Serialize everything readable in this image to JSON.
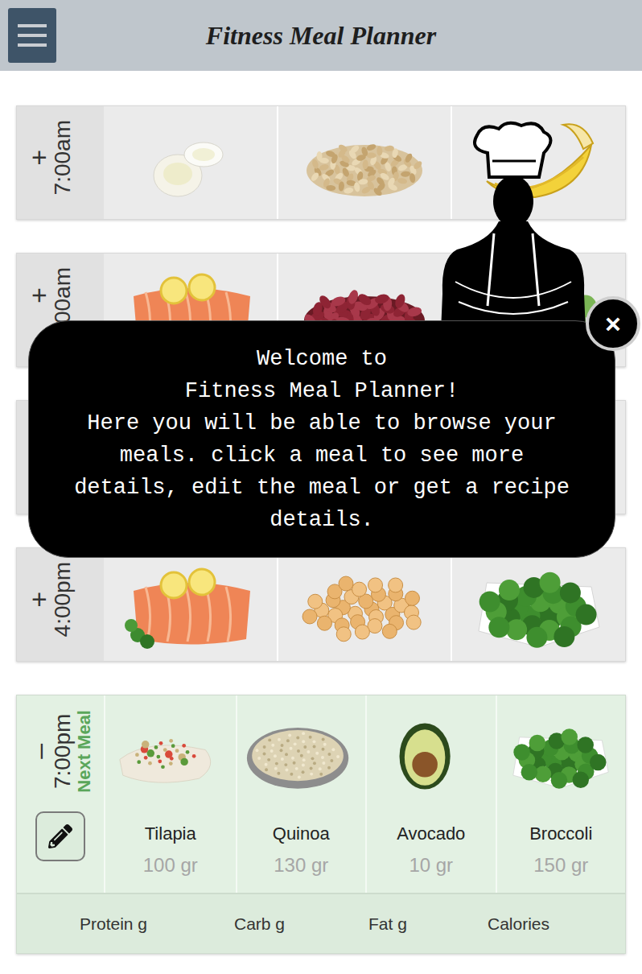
{
  "header": {
    "title": "Fitness Meal Planner"
  },
  "meals": [
    {
      "sign": "+",
      "time": "7:00am",
      "next": false,
      "expanded": false,
      "items": [
        {
          "kind": "egg"
        },
        {
          "kind": "oats"
        },
        {
          "kind": "banana"
        }
      ]
    },
    {
      "sign": "+",
      "time": "00am",
      "next": false,
      "expanded": false,
      "items": [
        {
          "kind": "salmon"
        },
        {
          "kind": "beans"
        },
        {
          "kind": "greens"
        }
      ]
    },
    {
      "next": false,
      "expanded": false,
      "items": []
    },
    {
      "sign": "+",
      "time": "4:00pm",
      "next": false,
      "expanded": false,
      "items": [
        {
          "kind": "salmon"
        },
        {
          "kind": "chickpeas"
        },
        {
          "kind": "broccoli"
        }
      ]
    },
    {
      "sign": "–",
      "time": "7:00pm",
      "next": true,
      "expanded": true,
      "next_label": "Next Meal",
      "items": [
        {
          "kind": "tilapia",
          "name": "Tilapia",
          "amount": "100 gr"
        },
        {
          "kind": "quinoa",
          "name": "Quinoa",
          "amount": "130 gr"
        },
        {
          "kind": "avocado",
          "name": "Avocado",
          "amount": "10 gr"
        },
        {
          "kind": "broccoli",
          "name": "Broccoli",
          "amount": "150 gr"
        }
      ],
      "totals": [
        "Protein g",
        "Carb g",
        "Fat g",
        "Calories"
      ]
    }
  ],
  "tour": {
    "lines": [
      "Welcome to",
      "Fitness Meal Planner!",
      "Here you will be able to browse your",
      "meals. click a meal to see more",
      "details, edit the meal or get a recipe",
      "details."
    ],
    "close": "×"
  }
}
